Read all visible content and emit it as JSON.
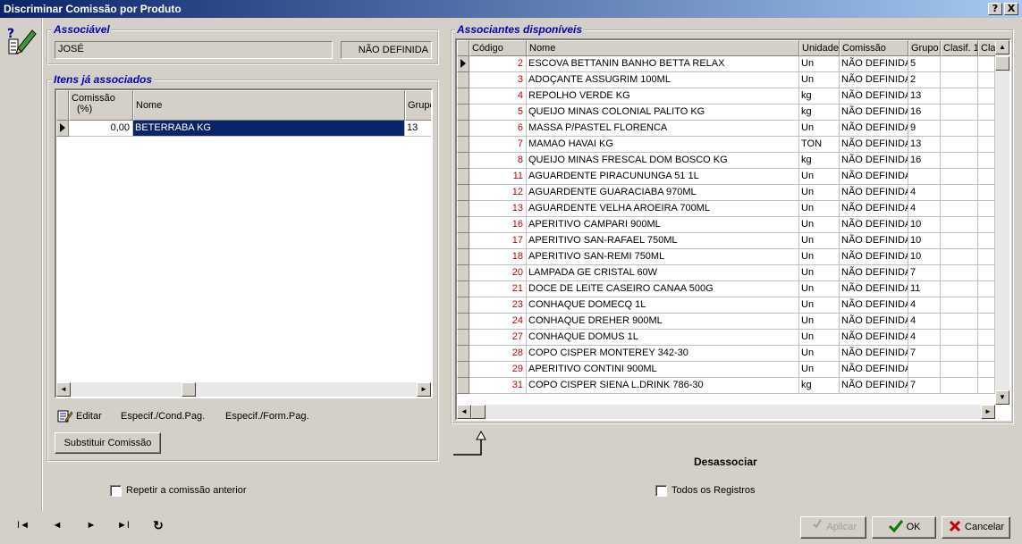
{
  "window": {
    "title": "Discriminar Comissão por Produto",
    "help_btn": "?",
    "close_btn": "X"
  },
  "associavel": {
    "label": "Associável",
    "name": "JOSÉ",
    "status": "NÃO DEFINIDA"
  },
  "itens": {
    "label": "Itens já associados",
    "col_comissao": "Comissão (%)",
    "col_comissao_1": "Comissão",
    "col_comissao_2": "(%)",
    "col_nome": "Nome",
    "col_grupo": "Grupo",
    "rows": [
      {
        "comissao": "0,00",
        "nome": "BETERRABA KG",
        "grupo": "13"
      }
    ],
    "editar": "Editar",
    "espec_cond": "Especif./Cond.Pag.",
    "espec_form": "Especif./Form.Pag.",
    "substituir": "Substituir Comissão"
  },
  "associantes": {
    "label": "Associantes disponíveis",
    "cols": [
      "Código",
      "Nome",
      "Unidade",
      "Comissão",
      "Grupo",
      "Clasif. 1",
      "Clas"
    ],
    "rows": [
      {
        "codigo": "2",
        "nome": "ESCOVA BETTANIN BANHO BETTA RELAX",
        "unidade": "Un",
        "comissao": "NÃO DEFINIDA",
        "grupo": "5"
      },
      {
        "codigo": "3",
        "nome": "ADOÇANTE ASSUGRIM 100ML",
        "unidade": "Un",
        "comissao": "NÃO DEFINIDA",
        "grupo": "2"
      },
      {
        "codigo": "4",
        "nome": "REPOLHO VERDE KG",
        "unidade": "kg",
        "comissao": "NÃO DEFINIDA",
        "grupo": "13"
      },
      {
        "codigo": "5",
        "nome": "QUEIJO MINAS COLONIAL PALITO KG",
        "unidade": "kg",
        "comissao": "NÃO DEFINIDA",
        "grupo": "16"
      },
      {
        "codigo": "6",
        "nome": "MASSA P/PASTEL FLORENCA",
        "unidade": "Un",
        "comissao": "NÃO DEFINIDA",
        "grupo": "9"
      },
      {
        "codigo": "7",
        "nome": "MAMAO HAVAI KG",
        "unidade": "TON",
        "comissao": "NÃO DEFINIDA",
        "grupo": "13"
      },
      {
        "codigo": "8",
        "nome": "QUEIJO MINAS FRESCAL DOM BOSCO KG",
        "unidade": "kg",
        "comissao": "NÃO DEFINIDA",
        "grupo": "16"
      },
      {
        "codigo": "11",
        "nome": "AGUARDENTE PIRACUNUNGA 51 1L",
        "unidade": "Un",
        "comissao": "NÃO DEFINIDA",
        "grupo": ""
      },
      {
        "codigo": "12",
        "nome": "AGUARDENTE GUARACIABA 970ML",
        "unidade": "Un",
        "comissao": "NÃO DEFINIDA",
        "grupo": "4"
      },
      {
        "codigo": "13",
        "nome": "AGUARDENTE VELHA AROEIRA 700ML",
        "unidade": "Un",
        "comissao": "NÃO DEFINIDA",
        "grupo": "4"
      },
      {
        "codigo": "16",
        "nome": "APERITIVO CAMPARI 900ML",
        "unidade": "Un",
        "comissao": "NÃO DEFINIDA",
        "grupo": "10"
      },
      {
        "codigo": "17",
        "nome": "APERITIVO SAN-RAFAEL 750ML",
        "unidade": "Un",
        "comissao": "NÃO DEFINIDA",
        "grupo": "10"
      },
      {
        "codigo": "18",
        "nome": "APERITIVO SAN-REMI 750ML",
        "unidade": "Un",
        "comissao": "NÃO DEFINIDA",
        "grupo": "10"
      },
      {
        "codigo": "20",
        "nome": "LAMPADA GE CRISTAL 60W",
        "unidade": "Un",
        "comissao": "NÃO DEFINIDA",
        "grupo": "7"
      },
      {
        "codigo": "21",
        "nome": "DOCE DE LEITE CASEIRO CANAA 500G",
        "unidade": "Un",
        "comissao": "NÃO DEFINIDA",
        "grupo": "11"
      },
      {
        "codigo": "23",
        "nome": "CONHAQUE DOMECQ 1L",
        "unidade": "Un",
        "comissao": "NÃO DEFINIDA",
        "grupo": "4"
      },
      {
        "codigo": "24",
        "nome": "CONHAQUE DREHER 900ML",
        "unidade": "Un",
        "comissao": "NÃO DEFINIDA",
        "grupo": "4"
      },
      {
        "codigo": "27",
        "nome": "CONHAQUE DOMUS 1L",
        "unidade": "Un",
        "comissao": "NÃO DEFINIDA",
        "grupo": "4"
      },
      {
        "codigo": "28",
        "nome": "COPO CISPER MONTEREY 342-30",
        "unidade": "Un",
        "comissao": "NÃO DEFINIDA",
        "grupo": "7"
      },
      {
        "codigo": "29",
        "nome": "APERITIVO CONTINI 900ML",
        "unidade": "Un",
        "comissao": "NÃO DEFINIDA",
        "grupo": ""
      },
      {
        "codigo": "31",
        "nome": "COPO CISPER SIENA L.DRINK 786-30",
        "unidade": "kg",
        "comissao": "NÃO DEFINIDA",
        "grupo": "7"
      }
    ],
    "desassociar": "Desassociar"
  },
  "options": {
    "repetir": "Repetir a comissão anterior",
    "todos": "Todos os Registros"
  },
  "nav": {
    "first": "I◄",
    "prev": "◄",
    "next": "►",
    "last": "►I",
    "refresh": "↻"
  },
  "buttons": {
    "aplicar": "Aplicar",
    "ok": "OK",
    "cancelar": "Cancelar"
  },
  "colors": {
    "title_start": "#0a246a",
    "title_end": "#a6caf0",
    "group_label": "#0000c0",
    "code_red": "#c00000",
    "selection": "#0a246a"
  }
}
